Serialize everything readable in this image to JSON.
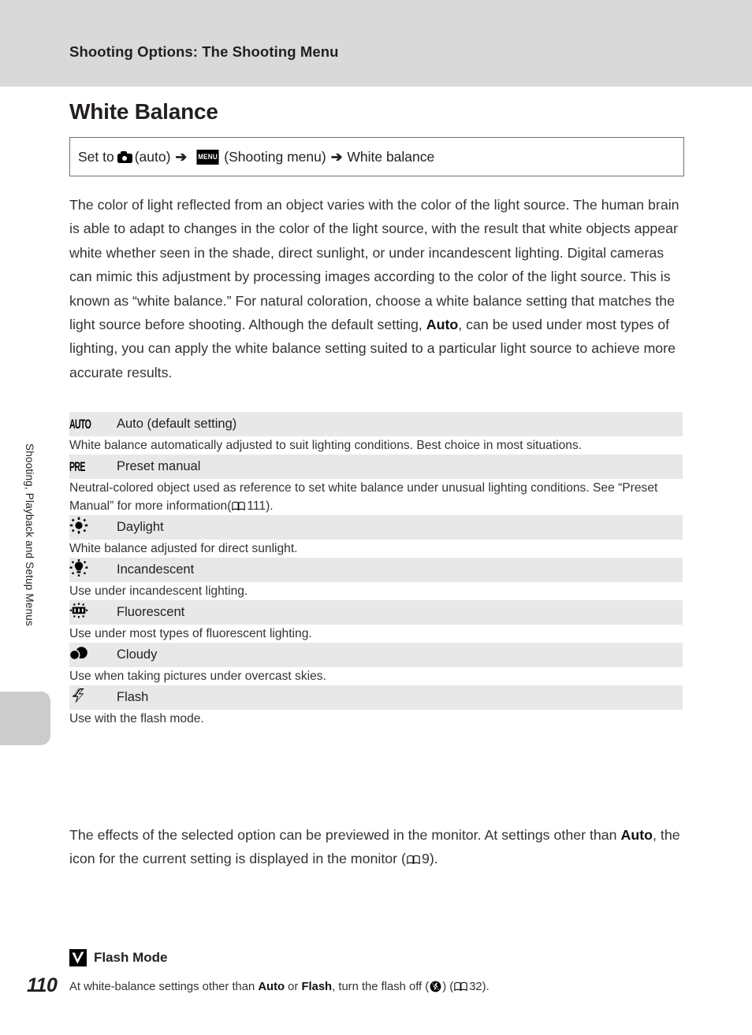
{
  "header": {
    "breadcrumb": "Shooting Options: The Shooting Menu"
  },
  "sidebar": {
    "vertical_label": "Shooting, Playback and Setup Menus"
  },
  "page": {
    "number": "110",
    "title": "White Balance"
  },
  "navpath": {
    "prefix": "Set to",
    "camera_icon": "camera-icon",
    "auto_text": "(auto)",
    "arrow1": "➔",
    "menu_icon_label": "MENU",
    "shooting_menu_text": "(Shooting menu)",
    "arrow2": "➔",
    "target": "White balance"
  },
  "intro_paragraph": {
    "part1": "The color of light reflected from an object varies with the color of the light source. The human brain is able to adapt to changes in the color of the light source, with the result that white objects appear white whether seen in the shade, direct sunlight, or under incandescent lighting. Digital cameras can mimic this adjustment by processing images according to the color of the light source. This is known as “white balance.” For natural coloration, choose a white balance setting that matches the light source before shooting. Although the default setting, ",
    "bold1": "Auto",
    "part2": ", can be used under most types of lighting, you can apply the white balance setting suited to a particular light source to achieve more accurate results."
  },
  "table": {
    "rows": [
      {
        "icon": "auto-text-icon",
        "icon_text": "AUTO",
        "label": "Auto (default setting)",
        "description": "White balance automatically adjusted to suit lighting conditions. Best choice in most situations."
      },
      {
        "icon": "preset-text-icon",
        "icon_text": "PRE",
        "label": "Preset manual",
        "description_part1": "Neutral-colored object used as reference to set white balance under unusual lighting conditions. See “Preset Manual” for more information(",
        "description_ref": "111",
        "description_part2": ")."
      },
      {
        "icon": "sun-icon",
        "label": "Daylight",
        "description": "White balance adjusted for direct sunlight."
      },
      {
        "icon": "incandescent-bulb-icon",
        "label": "Incandescent",
        "description": "Use under incandescent lighting."
      },
      {
        "icon": "fluorescent-tube-icon",
        "label": "Fluorescent",
        "description": "Use under most types of fluorescent lighting."
      },
      {
        "icon": "cloud-icon",
        "label": "Cloudy",
        "description": "Use when taking pictures under overcast skies."
      },
      {
        "icon": "flash-bolt-icon",
        "label": "Flash",
        "description": "Use with the flash mode."
      }
    ]
  },
  "closing_paragraph": {
    "part1": "The effects of the selected option can be previewed in the monitor. At settings other than ",
    "bold1": "Auto",
    "part2": ", the icon for the current setting is displayed in the monitor (",
    "ref": "9",
    "part3": ")."
  },
  "note": {
    "icon": "caution-check-icon",
    "title": "Flash Mode",
    "body_part1": "At white-balance settings other than ",
    "bold1": "Auto",
    "body_mid": " or ",
    "bold2": "Flash",
    "body_part2": ", turn the flash off (",
    "flash_off_icon": "flash-off-icon",
    "body_part3": ") (",
    "ref": "32",
    "body_part4": ")."
  },
  "colors": {
    "header_bg": "#d9d9d9",
    "row_bg": "#e8e8e8",
    "tab_bg": "#cccccc",
    "text": "#231f20"
  }
}
